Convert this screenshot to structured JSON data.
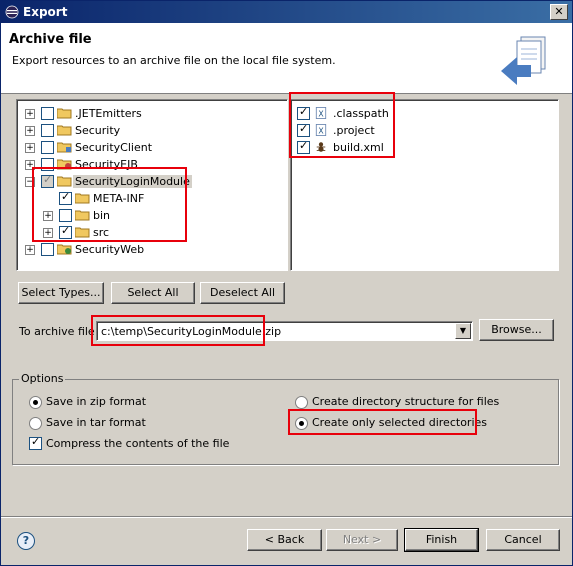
{
  "window": {
    "title": "Export"
  },
  "banner": {
    "title": "Archive file",
    "description": "Export resources to an archive file on the local file system."
  },
  "tree": {
    "items": [
      {
        "label": ".JETEmitters",
        "checked": false
      },
      {
        "label": "Security",
        "checked": false
      },
      {
        "label": "SecurityClient",
        "checked": false
      },
      {
        "label": "SecurityEJB",
        "checked": false
      },
      {
        "label": "SecurityLoginModule",
        "checked": true,
        "grayed": true
      },
      {
        "label": "META-INF",
        "checked": true
      },
      {
        "label": "bin",
        "checked": false
      },
      {
        "label": "src",
        "checked": true
      },
      {
        "label": "SecurityWeb",
        "checked": false
      }
    ]
  },
  "files": {
    "items": [
      {
        "label": ".classpath",
        "checked": true
      },
      {
        "label": ".project",
        "checked": true
      },
      {
        "label": "build.xml",
        "checked": true
      }
    ]
  },
  "buttons": {
    "select_types": "Select Types...",
    "select_all": "Select All",
    "deselect_all": "Deselect All",
    "browse": "Browse...",
    "back": "< Back",
    "next": "Next >",
    "finish": "Finish",
    "cancel": "Cancel"
  },
  "archive": {
    "label": "To archive file:",
    "value": "c:\\temp\\SecurityLoginModule.zip"
  },
  "options": {
    "title": "Options",
    "zip": "Save in zip format",
    "tar": "Save in tar format",
    "compress": "Compress the contents of the file",
    "dir_structure": "Create directory structure for files",
    "only_selected": "Create only selected directories"
  }
}
